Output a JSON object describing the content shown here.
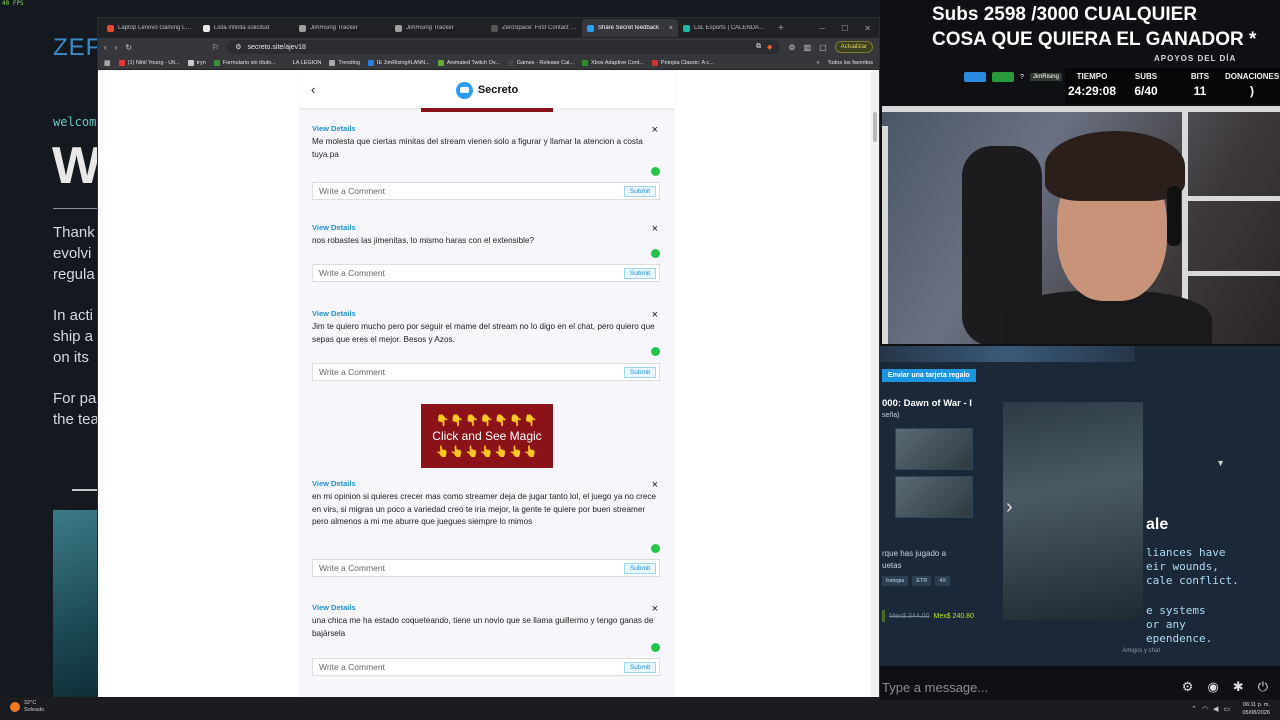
{
  "desktop": {
    "fps": "40 FPS",
    "bg_logo": "ZEF",
    "bg_welcome": "welcom",
    "bg_big": "W",
    "bg_paragraphs": [
      "Thank",
      "evolvi",
      "regula",
      "In acti",
      "ship a",
      "on its",
      "For pa",
      "the tea"
    ],
    "weather_temp": "32°C",
    "weather_desc": "Soleado"
  },
  "browser": {
    "tabs": [
      {
        "label": "Laptop Lenovo Gaming Le...",
        "color": "#e04c2f"
      },
      {
        "label": "Lista infinita solicitud",
        "color": "#e6e6e6"
      },
      {
        "label": "JimRising Tracker",
        "color": "#a0a0a0"
      },
      {
        "label": "JimRising Tracker",
        "color": "#a0a0a0"
      },
      {
        "label": "ZeroSpace: First Contact f...",
        "color": "#555"
      },
      {
        "label": "Share Secret feedback",
        "color": "#2a9df4",
        "active": true
      },
      {
        "label": "LoL Esports | CALENDARIO",
        "color": "#1fb8a8"
      }
    ],
    "tab_close": "×",
    "new_tab": "+",
    "url": "secreto.site/ajev18",
    "update_label": "Actualizar",
    "bookmarks": [
      {
        "label": "(1) Nihil Young - Ult...",
        "color": "#e33"
      },
      {
        "label": "tryn",
        "color": "#ccc"
      },
      {
        "label": "Formulario sin título...",
        "color": "#3a8f3a"
      },
      {
        "label": "LA LEGION",
        "color": "#333"
      },
      {
        "label": "Trending",
        "color": "#aaa"
      },
      {
        "label": "IE JimRising#LANN...",
        "color": "#2a7de1"
      },
      {
        "label": "Animated Twitch Ov...",
        "color": "#6a3"
      },
      {
        "label": "Games - Release Cal...",
        "color": "#444"
      },
      {
        "label": "Xbox Adaptive Cont...",
        "color": "#2a8f2a"
      },
      {
        "label": "Petopia Classic: A c...",
        "color": "#c33"
      }
    ],
    "bookmarks_more": "»",
    "all_bookmarks": "Todos los favoritos"
  },
  "page": {
    "brand": "Secreto",
    "back": "‹",
    "view_details": "View Details",
    "close": "×",
    "comment_placeholder": "Write a Comment",
    "submit": "Submit",
    "magic_hands_top": "👇👇👇👇👇👇👇",
    "magic_text": "Click and See Magic",
    "magic_hands_bottom": "👆👆👆👆👆👆👆",
    "messages": [
      "Me molesta que ciertas minitas del stream vienen solo a figurar y llamar la atencion a costa tuya pa",
      "nos robastes las jimenitas, lo mismo haras con el extensible?",
      "Jim te quiero mucho pero por seguir el mame del stream no lo digo en el chat, pero quiero que sepas que eres el mejor. Besos y Azos.",
      "en mi opinion si quieres crecer mas como streamer deja de jugar tanto lol, el juego ya no crece en virs, si migras un poco a variedad creo te iria mejor, la gente te quiere por buen streamer pero almenos a mi me aburre que juegues siempre lo mimos",
      "una chica me ha estado coqueteando, tiene un novio que se llama guillermo y tengo ganas de bajársela"
    ]
  },
  "stream": {
    "subs_line1": "Subs 2598 /3000 CUALQUIER",
    "subs_line2": "COSA QUE QUIERA EL GANADOR *",
    "apoyos": "APOYOS DEL DÍA",
    "channel_tag": "JimRising",
    "stats": [
      {
        "label": "TIEMPO",
        "value": "24:29:08"
      },
      {
        "label": "SUBS",
        "value": "6/40"
      },
      {
        "label": "BITS",
        "value": "11"
      },
      {
        "label": "DONACIONES",
        "value": ")"
      }
    ],
    "steam": {
      "gift": "Enviar una tarjeta regalo",
      "game": "000: Dawn of War - I",
      "reviews": "seña)",
      "played": "rque has jugado a",
      "played2": "uetas",
      "tags": [
        "trategia",
        "ETR",
        "4X"
      ],
      "old_price": "Mex$ 344.00",
      "new_price": "Mex$ 240.80",
      "hero_title": "ale",
      "desc1": [
        "liances have",
        "eir wounds,",
        "cale conflict."
      ],
      "desc2": [
        "e systems",
        "or any",
        "ependence."
      ],
      "friends": "Amigos y chat"
    },
    "chat_placeholder": "Type a message...",
    "clock_time": "06:11 p. m.",
    "clock_date": "05/08/2026"
  }
}
